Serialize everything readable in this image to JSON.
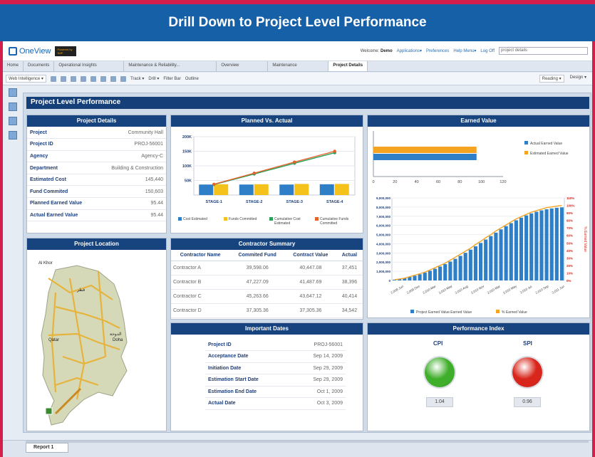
{
  "banner": {
    "title": "Drill Down to Project Level Performance"
  },
  "app": {
    "logo": "OneView",
    "logo_badge": "Powered by SAP",
    "welcome_label": "Welcome:",
    "user": "Demo",
    "links": [
      "Applications▾",
      "Preferences",
      "Help Menu▾",
      "Log Off"
    ],
    "search_value": "project details"
  },
  "tabs": [
    "Home",
    "Documents",
    "Operational Insights",
    "Maintenance & Reliability...",
    "Overview",
    "Maintenance",
    "Project Details"
  ],
  "toolbar": {
    "web_intelligence": "Web Intelligence ▾",
    "track": "Track ▾",
    "drill": "Drill ▾",
    "filter_bar": "Filter Bar",
    "outline": "Outline",
    "reading": "Reading ▾",
    "design": "Design ▾"
  },
  "report": {
    "title": "Project Level Performance",
    "tab": "Report 1"
  },
  "project_details": {
    "title": "Project Details",
    "rows": [
      {
        "k": "Project",
        "v": "Community Hall"
      },
      {
        "k": "Project ID",
        "v": "PROJ-56001"
      },
      {
        "k": "Agency",
        "v": "Agency-C"
      },
      {
        "k": "Department",
        "v": "Building & Construction"
      },
      {
        "k": "Estimated Cost",
        "v": "145,440"
      },
      {
        "k": "Fund Commited",
        "v": "150,603"
      },
      {
        "k": "Planned Earned Value",
        "v": "95.44"
      },
      {
        "k": "Actual Earned Value",
        "v": "95.44"
      }
    ]
  },
  "planned_vs_actual": {
    "title": "Planned Vs. Actual"
  },
  "earned_value": {
    "title": "Earned Value"
  },
  "project_location": {
    "title": "Project Location",
    "labels": [
      "Al Khor",
      "Doha",
      "الدوحة",
      "قطر",
      "Qatar"
    ]
  },
  "contractor_summary": {
    "title": "Contractor Summary",
    "headers": [
      "Contractor Name",
      "Commited Fund",
      "Contract Value",
      "Actual"
    ],
    "rows": [
      [
        "Contractor A",
        "39,598.06",
        "40,447.08",
        "37,451"
      ],
      [
        "Contractor B",
        "47,227.09",
        "41,487.69",
        "38,396"
      ],
      [
        "Contractor C",
        "45,263.66",
        "43,647.12",
        "40,414"
      ],
      [
        "Contractor D",
        "37,305.36",
        "37,305.36",
        "34,542"
      ]
    ]
  },
  "important_dates": {
    "title": "Important Dates",
    "rows": [
      {
        "k": "Project ID",
        "v": "PROJ-56001"
      },
      {
        "k": "Acceptance Date",
        "v": "Sep 14, 2009"
      },
      {
        "k": "Initiation Date",
        "v": "Sep 29, 2009"
      },
      {
        "k": "Estimation Start Date",
        "v": "Sep 29, 2009"
      },
      {
        "k": "Estimation End Date",
        "v": "Oct 1, 2009"
      },
      {
        "k": "Actual Date",
        "v": "Oct 3, 2009"
      }
    ]
  },
  "performance_index": {
    "title": "Performance Index",
    "cpi_label": "CPI",
    "cpi_value": "1.04",
    "cpi_color": "#3fae2a",
    "spi_label": "SPI",
    "spi_value": "0.96",
    "spi_color": "#d8261c"
  },
  "chart_data": [
    {
      "type": "bar",
      "title": "Planned Vs. Actual",
      "categories": [
        "STAGE-1",
        "STAGE-2",
        "STAGE-3",
        "STAGE-4"
      ],
      "yticks": [
        "200K",
        "150K",
        "100K",
        "50K"
      ],
      "ylim": [
        0,
        200000
      ],
      "series": [
        {
          "name": "Cost Estimated",
          "kind": "bar",
          "color": "#2f7fc8",
          "values": [
            36000,
            36000,
            36000,
            37000
          ]
        },
        {
          "name": "Funds Committed",
          "kind": "bar",
          "color": "#f4c21b",
          "values": [
            37000,
            37000,
            38000,
            38000
          ]
        },
        {
          "name": "Cumulative Cost Estimated",
          "kind": "line",
          "color": "#2aa05a",
          "values": [
            36000,
            72000,
            109000,
            145000
          ]
        },
        {
          "name": "Cumulative Funds Committed",
          "kind": "line",
          "color": "#e5632a",
          "values": [
            37000,
            75000,
            113000,
            150000
          ]
        }
      ]
    },
    {
      "type": "bar",
      "title": "Earned Value",
      "orientation": "horizontal",
      "xticks": [
        "0",
        "20",
        "40",
        "60",
        "80",
        "100",
        "120"
      ],
      "xlim": [
        0,
        120
      ],
      "legend": "right",
      "series": [
        {
          "name": "Actual Earned Value",
          "color": "#2f7fc8",
          "value": 95.44
        },
        {
          "name": "Estimated Earned Value",
          "color": "#f4a421",
          "value": 95.44
        }
      ]
    },
    {
      "type": "bar",
      "title": "",
      "yticks": [
        "9,000,000",
        "8,000,000",
        "7,000,000",
        "6,000,000",
        "5,000,000",
        "4,000,000",
        "3,000,000",
        "2,000,000",
        "1,000,000",
        "0"
      ],
      "y2ticks": [
        "110%",
        "100%",
        "90%",
        "80%",
        "70%",
        "60%",
        "50%",
        "40%",
        "30%",
        "20%",
        "10%",
        "0%"
      ],
      "y2label": "% Earned Value",
      "xticks": [
        "2,009 Jun",
        "2,009 Dec",
        "2,010 Mar",
        "2,010 May",
        "2,010 Aug",
        "2,010 Nov",
        "2,010 Mar",
        "2,010 May",
        "2,010 Jul",
        "2,010 Sep",
        "2,011 Jun"
      ],
      "ylim": [
        0,
        9000000
      ],
      "series": [
        {
          "name": "Project Earned Value.Earned Value",
          "kind": "bar",
          "color": "#2f7fc8",
          "values": [
            80000,
            150000,
            250000,
            380000,
            520000,
            680000,
            860000,
            1060000,
            1280000,
            1520000,
            1780000,
            2060000,
            2360000,
            2680000,
            3010000,
            3360000,
            3720000,
            4090000,
            4460000,
            4840000,
            5210000,
            5570000,
            5920000,
            6250000,
            6560000,
            6840000,
            7090000,
            7310000,
            7490000,
            7640000,
            7760000,
            7850000,
            7920000,
            7970000
          ]
        },
        {
          "name": "% Earned Value",
          "kind": "line",
          "color": "#f4a421",
          "values": [
            1,
            2,
            3,
            5,
            7,
            9,
            11,
            14,
            17,
            20,
            23,
            27,
            31,
            35,
            39,
            43,
            48,
            52,
            57,
            61,
            66,
            70,
            74,
            78,
            82,
            85,
            88,
            91,
            93,
            95,
            97,
            98,
            99,
            100
          ]
        }
      ]
    }
  ]
}
